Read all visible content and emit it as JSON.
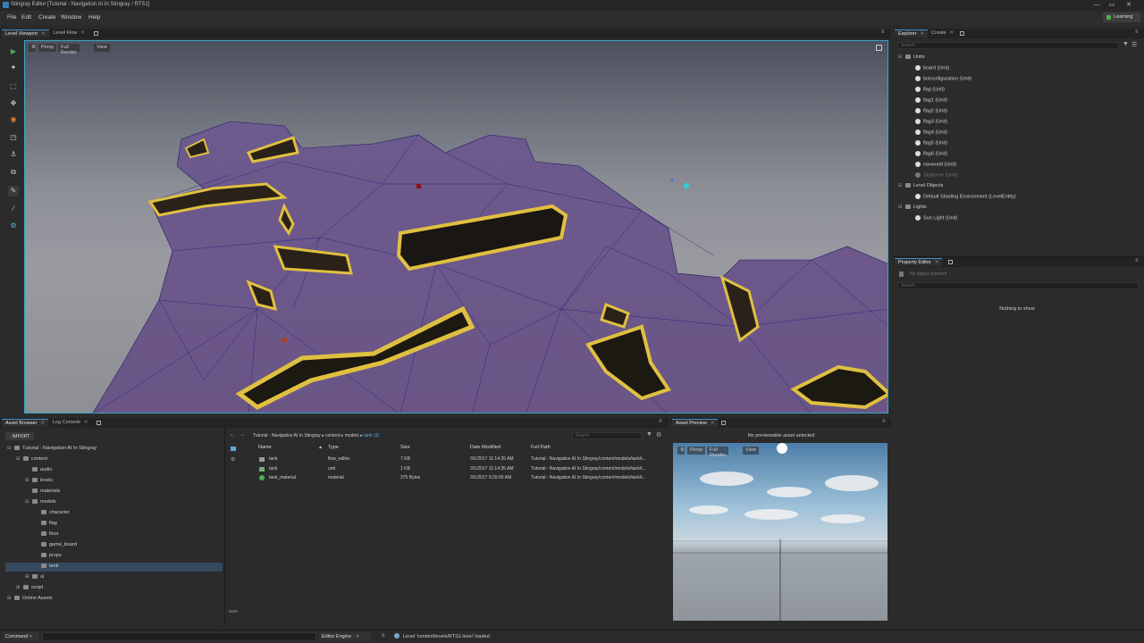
{
  "window": {
    "title": "Stingray Editor [Tutorial - Navigation AI In Stingray / RTS1]",
    "controls": [
      "—",
      "▭",
      "✕"
    ]
  },
  "menu": {
    "items": [
      "File",
      "Edit",
      "Create",
      "Window",
      "Help"
    ],
    "learning_label": "Learning"
  },
  "viewport_panel": {
    "tabs": [
      "Level Viewport",
      "Level Flow"
    ],
    "toolbar": [
      "Persp",
      "Full Render",
      "View"
    ]
  },
  "explorer": {
    "tabs": [
      "Explorer",
      "Create"
    ],
    "search_placeholder": "Search",
    "groups": [
      {
        "label": "Units",
        "items": [
          "board (Unit)",
          "botconfiguration (Unit)",
          "flag (Unit)",
          "flag1 (Unit)",
          "flag2 (Unit)",
          "flag3 (Unit)",
          "flag4 (Unit)",
          "flag5 (Unit)",
          "flag6 (Unit)",
          "navworld (Unit)",
          "Skydome (Unit)"
        ]
      },
      {
        "label": "Level Objects",
        "items": [
          "Default Shading Environment (LevelEntity)"
        ]
      },
      {
        "label": "Lights",
        "items": [
          "Sun Light (Unit)"
        ]
      }
    ]
  },
  "property_editor": {
    "title": "Property Editor",
    "no_selection": "No object selected",
    "search_placeholder": "Search",
    "empty_message": "Nothing to show"
  },
  "asset_browser": {
    "tabs": [
      "Asset Browser",
      "Log Console"
    ],
    "import_label": "IMPORT",
    "tree": [
      {
        "label": "Tutorial - Navigation AI In Stingray",
        "depth": 0
      },
      {
        "label": "content",
        "depth": 1
      },
      {
        "label": "audio",
        "depth": 2
      },
      {
        "label": "levels",
        "depth": 2
      },
      {
        "label": "materials",
        "depth": 2
      },
      {
        "label": "models",
        "depth": 2
      },
      {
        "label": "character",
        "depth": 3
      },
      {
        "label": "flag",
        "depth": 3
      },
      {
        "label": "floor",
        "depth": 3
      },
      {
        "label": "game_board",
        "depth": 3
      },
      {
        "label": "props",
        "depth": 3
      },
      {
        "label": "tank",
        "depth": 3
      },
      {
        "label": "ui",
        "depth": 2
      },
      {
        "label": "script",
        "depth": 1
      },
      {
        "label": "Online Assets",
        "depth": 0
      }
    ],
    "breadcrumb": [
      "Tutorial - Navigation AI In Stingray",
      "content",
      "models",
      "tank (3)"
    ],
    "search_placeholder": "Search",
    "columns": [
      "Name",
      "Type",
      "Size",
      "Date Modified",
      "Full Path"
    ],
    "rows": [
      {
        "name": "tank",
        "type": "flow_editor",
        "size": "7 KB",
        "date": "3/1/2017 11:14:35 AM",
        "path": "Tutorial - Navigation AI In Stingray/content/models/tank/t..."
      },
      {
        "name": "tank",
        "type": "unit",
        "size": "1 KB",
        "date": "3/1/2017 11:14:35 AM",
        "path": "Tutorial - Navigation AI In Stingray/content/models/tank/t..."
      },
      {
        "name": "tank_material",
        "type": "material",
        "size": "375 Bytes",
        "date": "3/1/2017 9:20:00 AM",
        "path": "Tutorial - Navigation AI In Stingray/content/models/tank/t..."
      }
    ]
  },
  "asset_preview": {
    "title": "Asset Preview",
    "message": "No previewable asset selected",
    "toolbar": [
      "Persp",
      "Full Render",
      "View"
    ]
  },
  "status": {
    "command_label": "Command",
    "engine_label": "Editor Engine",
    "message": "Level 'content/levels/RTS1.level' loaded."
  },
  "colors": {
    "accent": "#3aa7c9",
    "navmesh": "#7a5a9e",
    "walls": "#d8b434",
    "selected_row": "#34495e"
  }
}
